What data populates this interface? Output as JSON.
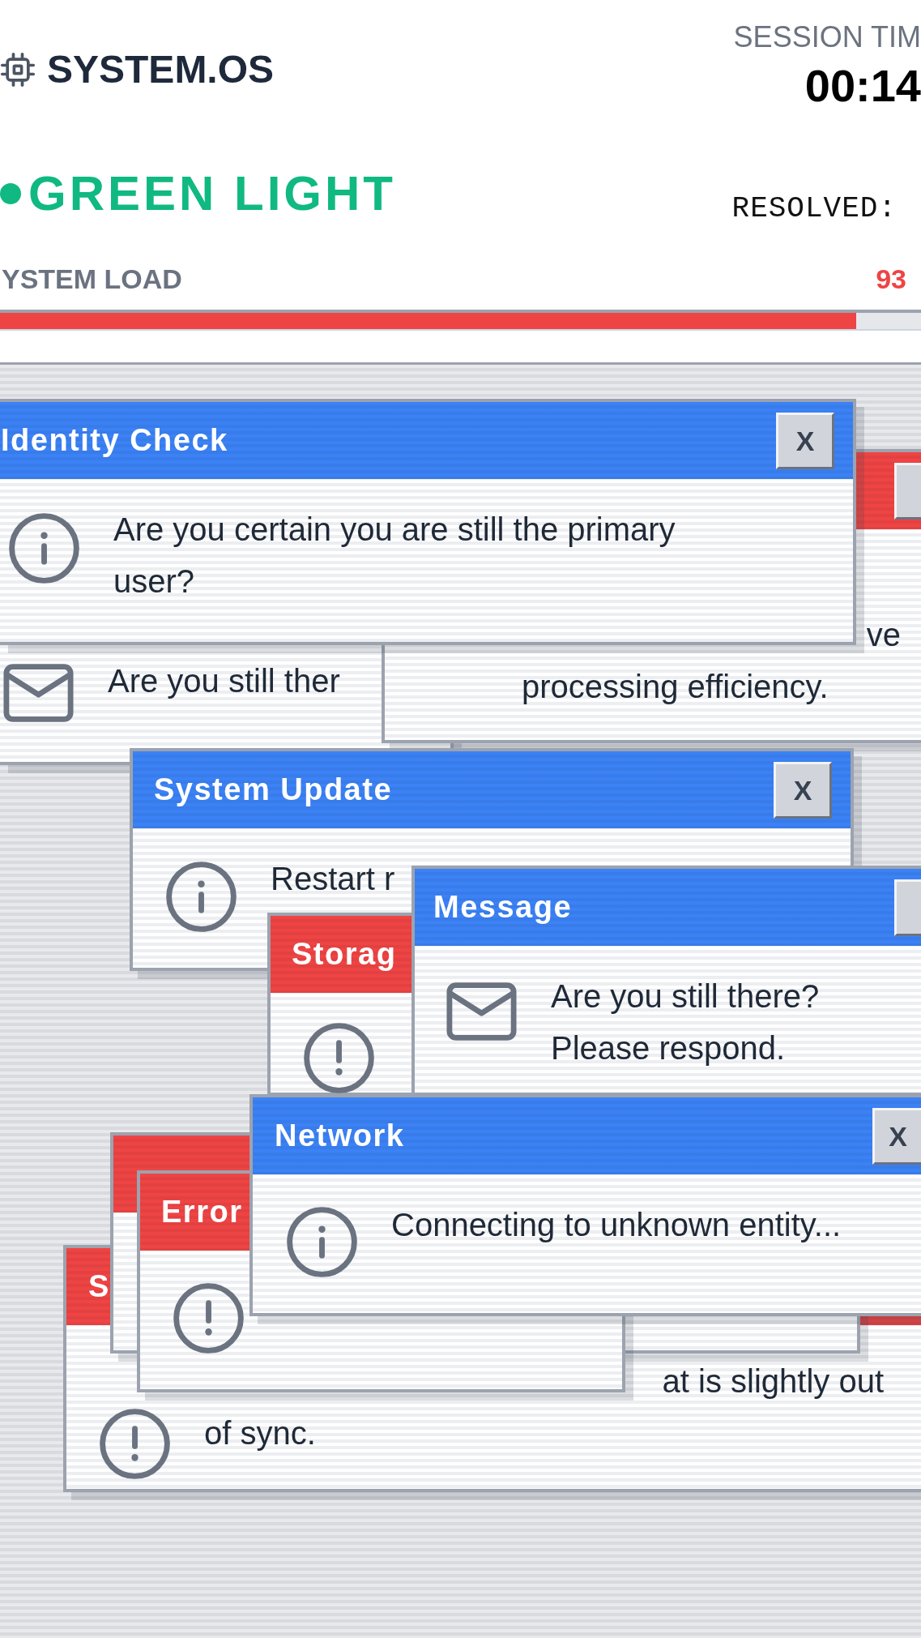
{
  "header": {
    "brand": "SYSTEM.OS",
    "session_label": "SESSION TIM",
    "session_time": "00:14"
  },
  "status": {
    "label": "GREEN LIGHT",
    "resolved_label": "RESOLVED:"
  },
  "system_load": {
    "label": "YSTEM LOAD",
    "reading": "93",
    "level": 0.93
  },
  "windows": [
    {
      "kind": "notice",
      "title": "Identity Check",
      "close": "X",
      "message": [
        "Are you certain you are still the primary",
        "user?"
      ]
    },
    {
      "message": [
        "Are you still ther"
      ]
    },
    {
      "kind": "alert",
      "message": [
        "ve",
        "processing efficiency."
      ]
    },
    {
      "kind": "notice",
      "title": "System Update",
      "close": "X",
      "message": [
        "Restart r"
      ]
    },
    {
      "kind": "notice",
      "title": "Message",
      "message": [
        "Are you still there?",
        "Please respond."
      ]
    },
    {
      "kind": "alert",
      "title": "Storag"
    },
    {
      "kind": "notice",
      "title": "Network",
      "close": "X",
      "message": [
        "Connecting to unknown entity..."
      ]
    },
    {
      "kind": "alert"
    },
    {
      "kind": "alert",
      "title": "Error"
    },
    {
      "kind": "alert",
      "title": "S",
      "message": [
        "at is slightly out",
        "of sync."
      ]
    }
  ]
}
